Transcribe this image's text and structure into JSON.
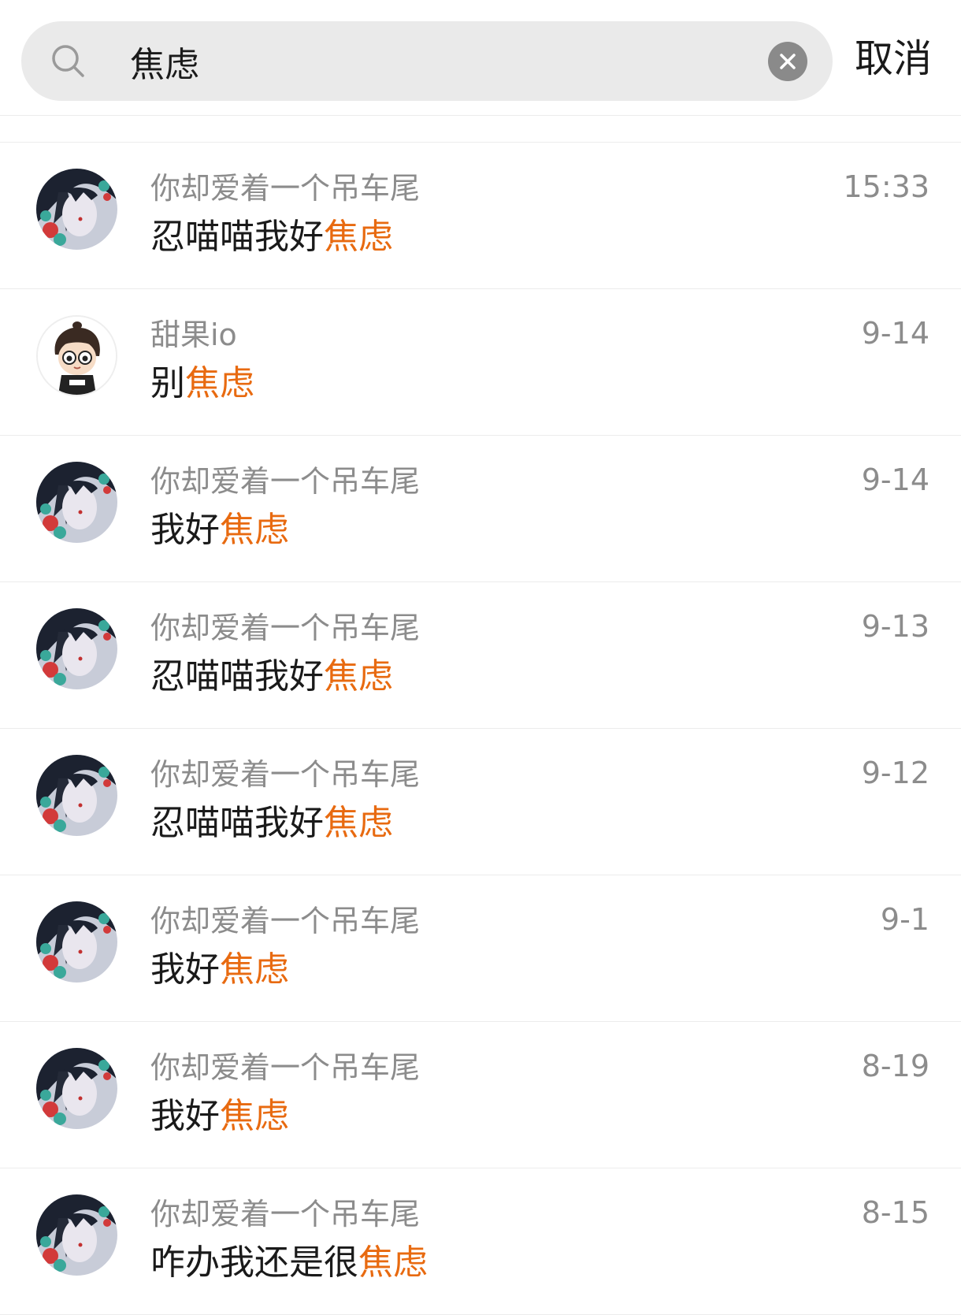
{
  "search": {
    "query": "焦虑",
    "cancel_label": "取消"
  },
  "colors": {
    "highlight": "#e86a10",
    "secondary_text": "#8c8c8c",
    "search_bg": "#eaeaea"
  },
  "results": [
    {
      "sender": "你却爱着一个吊车尾",
      "msg_prefix": "忍喵喵我好",
      "msg_match": "焦虑",
      "time": "15:33",
      "avatar": "anime-avatar"
    },
    {
      "sender": "甜果io",
      "msg_prefix": "别",
      "msg_match": "焦虑",
      "time": "9-14",
      "avatar": "cartoon-avatar"
    },
    {
      "sender": "你却爱着一个吊车尾",
      "msg_prefix": "我好",
      "msg_match": "焦虑",
      "time": "9-14",
      "avatar": "anime-avatar"
    },
    {
      "sender": "你却爱着一个吊车尾",
      "msg_prefix": "忍喵喵我好",
      "msg_match": "焦虑",
      "time": "9-13",
      "avatar": "anime-avatar"
    },
    {
      "sender": "你却爱着一个吊车尾",
      "msg_prefix": "忍喵喵我好",
      "msg_match": "焦虑",
      "time": "9-12",
      "avatar": "anime-avatar"
    },
    {
      "sender": "你却爱着一个吊车尾",
      "msg_prefix": "我好",
      "msg_match": "焦虑",
      "time": "9-1",
      "avatar": "anime-avatar"
    },
    {
      "sender": "你却爱着一个吊车尾",
      "msg_prefix": "我好",
      "msg_match": "焦虑",
      "time": "8-19",
      "avatar": "anime-avatar"
    },
    {
      "sender": "你却爱着一个吊车尾",
      "msg_prefix": "咋办我还是很",
      "msg_match": "焦虑",
      "time": "8-15",
      "avatar": "anime-avatar"
    }
  ]
}
